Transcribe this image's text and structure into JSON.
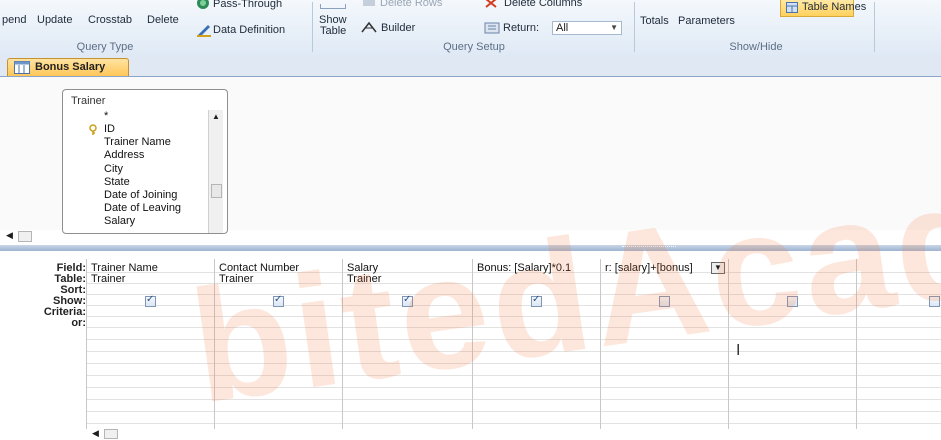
{
  "ribbon": {
    "query_type": {
      "buttons": [
        "pend",
        "Update",
        "Crosstab",
        "Delete"
      ],
      "items": [
        "Pass-Through",
        "Data Definition"
      ],
      "group_label": "Query Type"
    },
    "query_setup": {
      "show_table": [
        "Show",
        "Table"
      ],
      "delete_rows": "Delete Rows",
      "builder": "Builder",
      "delete_columns": "Delete Columns",
      "return_label": "Return:",
      "return_value": "All",
      "group_label": "Query Setup"
    },
    "show_hide": {
      "totals": "Totals",
      "parameters": "Parameters",
      "table_names": "Table Names",
      "group_label": "Show/Hide"
    }
  },
  "document_tab": {
    "label": "Bonus Salary"
  },
  "table_box": {
    "title": "Trainer",
    "fields": [
      "*",
      "ID",
      "Trainer Name",
      "Address",
      "City",
      "State",
      "Date of Joining",
      "Date of Leaving",
      "Salary"
    ]
  },
  "grid": {
    "row_labels": [
      "Field:",
      "Table:",
      "Sort:",
      "Show:",
      "Criteria:",
      "or:"
    ],
    "columns": [
      {
        "field": "Trainer Name",
        "table": "Trainer",
        "show": true
      },
      {
        "field": "Contact Number",
        "table": "Trainer",
        "show": true
      },
      {
        "field": "Salary",
        "table": "Trainer",
        "show": true
      },
      {
        "field": "Bonus: [Salary]*0.1",
        "table": "",
        "show": true
      },
      {
        "field": "r: [salary]+[bonus]",
        "table": "",
        "show": false
      },
      {
        "field": "",
        "table": "",
        "show": false
      },
      {
        "field": "",
        "table": "",
        "show": false
      }
    ]
  },
  "watermark": "bitedAcad"
}
